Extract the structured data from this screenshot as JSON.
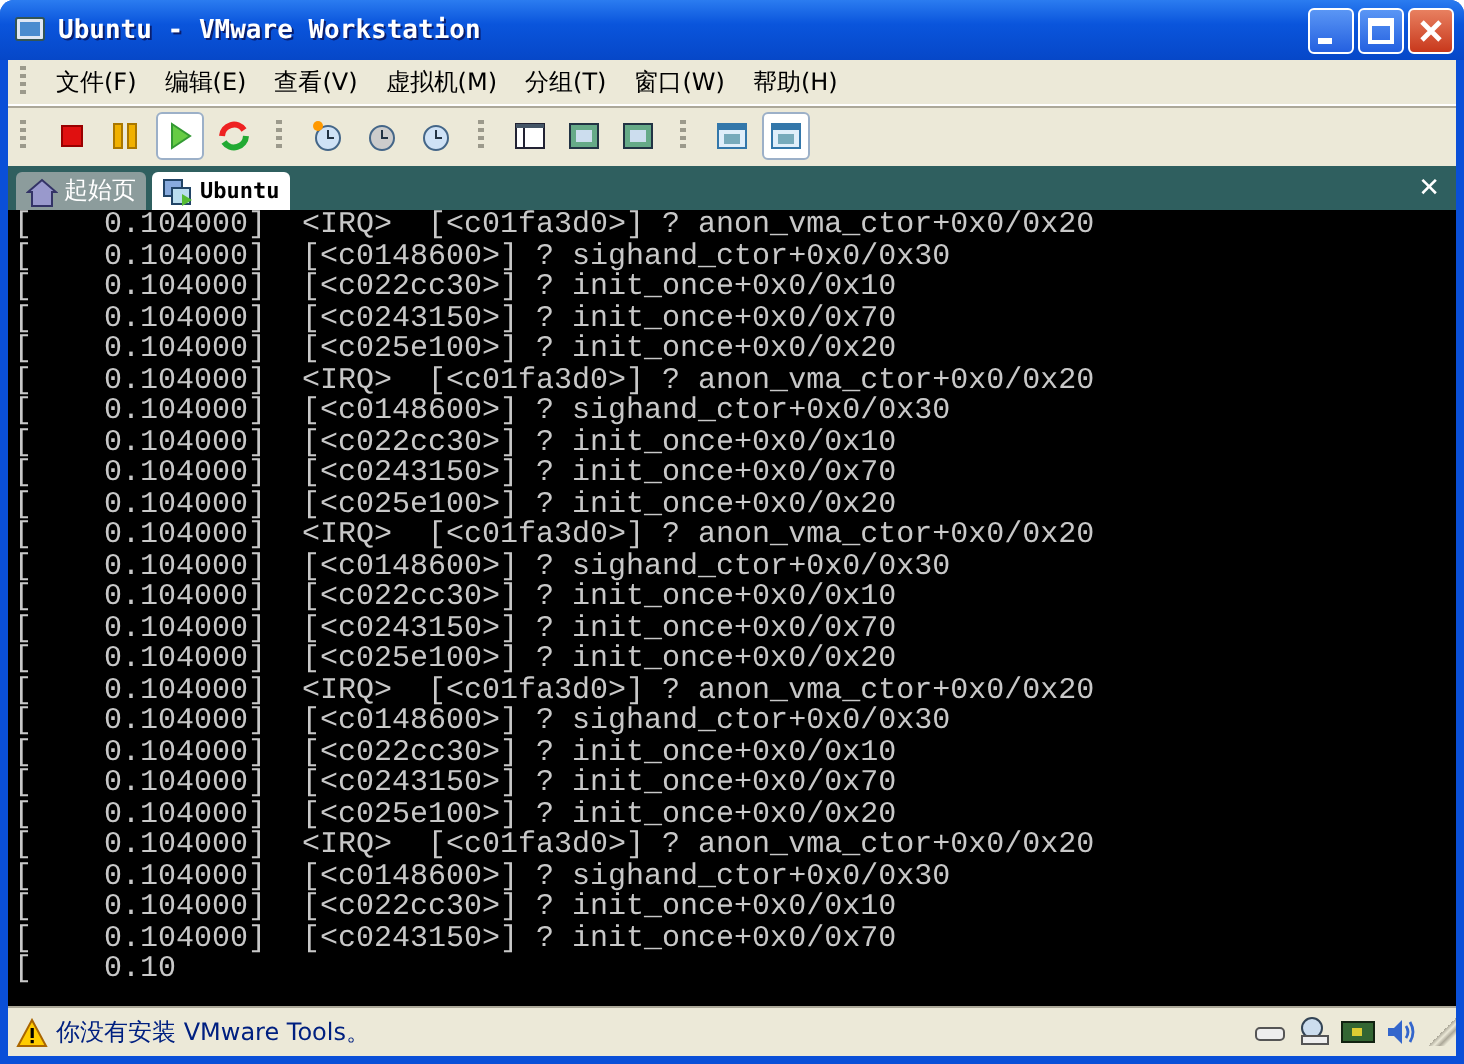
{
  "window": {
    "title": "Ubuntu - VMware Workstation"
  },
  "menu": [
    "文件(F)",
    "编辑(E)",
    "查看(V)",
    "虚拟机(M)",
    "分组(T)",
    "窗口(W)",
    "帮助(H)"
  ],
  "toolbar": [
    [
      {
        "kind": "stop",
        "pressed": false
      },
      {
        "kind": "pause",
        "pressed": false
      },
      {
        "kind": "play",
        "pressed": true
      },
      {
        "kind": "reset",
        "pressed": false
      }
    ],
    [
      {
        "kind": "snapshot",
        "pressed": false
      },
      {
        "kind": "revert",
        "pressed": false
      },
      {
        "kind": "manager",
        "pressed": false
      }
    ],
    [
      {
        "kind": "sidebar",
        "pressed": false
      },
      {
        "kind": "fullscreen",
        "pressed": false
      },
      {
        "kind": "quickswitch",
        "pressed": false
      }
    ],
    [
      {
        "kind": "summary",
        "pressed": false
      },
      {
        "kind": "console",
        "pressed": true
      }
    ]
  ],
  "tab_close": "✕",
  "tabs": [
    {
      "label": "起始页",
      "kind": "home",
      "selected": false
    },
    {
      "label": "Ubuntu",
      "kind": "vm",
      "selected": true
    }
  ],
  "console": [
    "[    0.104000]  <IRQ>  [<c01fa3d0>] ? anon_vma_ctor+0x0/0x20",
    "[    0.104000]  [<c0148600>] ? sighand_ctor+0x0/0x30",
    "[    0.104000]  [<c022cc30>] ? init_once+0x0/0x10",
    "[    0.104000]  [<c0243150>] ? init_once+0x0/0x70",
    "[    0.104000]  [<c025e100>] ? init_once+0x0/0x20",
    "[    0.104000]  <IRQ>  [<c01fa3d0>] ? anon_vma_ctor+0x0/0x20",
    "[    0.104000]  [<c0148600>] ? sighand_ctor+0x0/0x30",
    "[    0.104000]  [<c022cc30>] ? init_once+0x0/0x10",
    "[    0.104000]  [<c0243150>] ? init_once+0x0/0x70",
    "[    0.104000]  [<c025e100>] ? init_once+0x0/0x20",
    "[    0.104000]  <IRQ>  [<c01fa3d0>] ? anon_vma_ctor+0x0/0x20",
    "[    0.104000]  [<c0148600>] ? sighand_ctor+0x0/0x30",
    "[    0.104000]  [<c022cc30>] ? init_once+0x0/0x10",
    "[    0.104000]  [<c0243150>] ? init_once+0x0/0x70",
    "[    0.104000]  [<c025e100>] ? init_once+0x0/0x20",
    "[    0.104000]  <IRQ>  [<c01fa3d0>] ? anon_vma_ctor+0x0/0x20",
    "[    0.104000]  [<c0148600>] ? sighand_ctor+0x0/0x30",
    "[    0.104000]  [<c022cc30>] ? init_once+0x0/0x10",
    "[    0.104000]  [<c0243150>] ? init_once+0x0/0x70",
    "[    0.104000]  [<c025e100>] ? init_once+0x0/0x20",
    "[    0.104000]  <IRQ>  [<c01fa3d0>] ? anon_vma_ctor+0x0/0x20",
    "[    0.104000]  [<c0148600>] ? sighand_ctor+0x0/0x30",
    "[    0.104000]  [<c022cc30>] ? init_once+0x0/0x10",
    "[    0.104000]  [<c0243150>] ? init_once+0x0/0x70",
    "[    0.10"
  ],
  "status_bar": {
    "message": "你没有安装 VMware Tools。",
    "devices": [
      {
        "kind": "floppy"
      },
      {
        "kind": "cdrom"
      },
      {
        "kind": "network"
      },
      {
        "kind": "sound"
      }
    ]
  }
}
